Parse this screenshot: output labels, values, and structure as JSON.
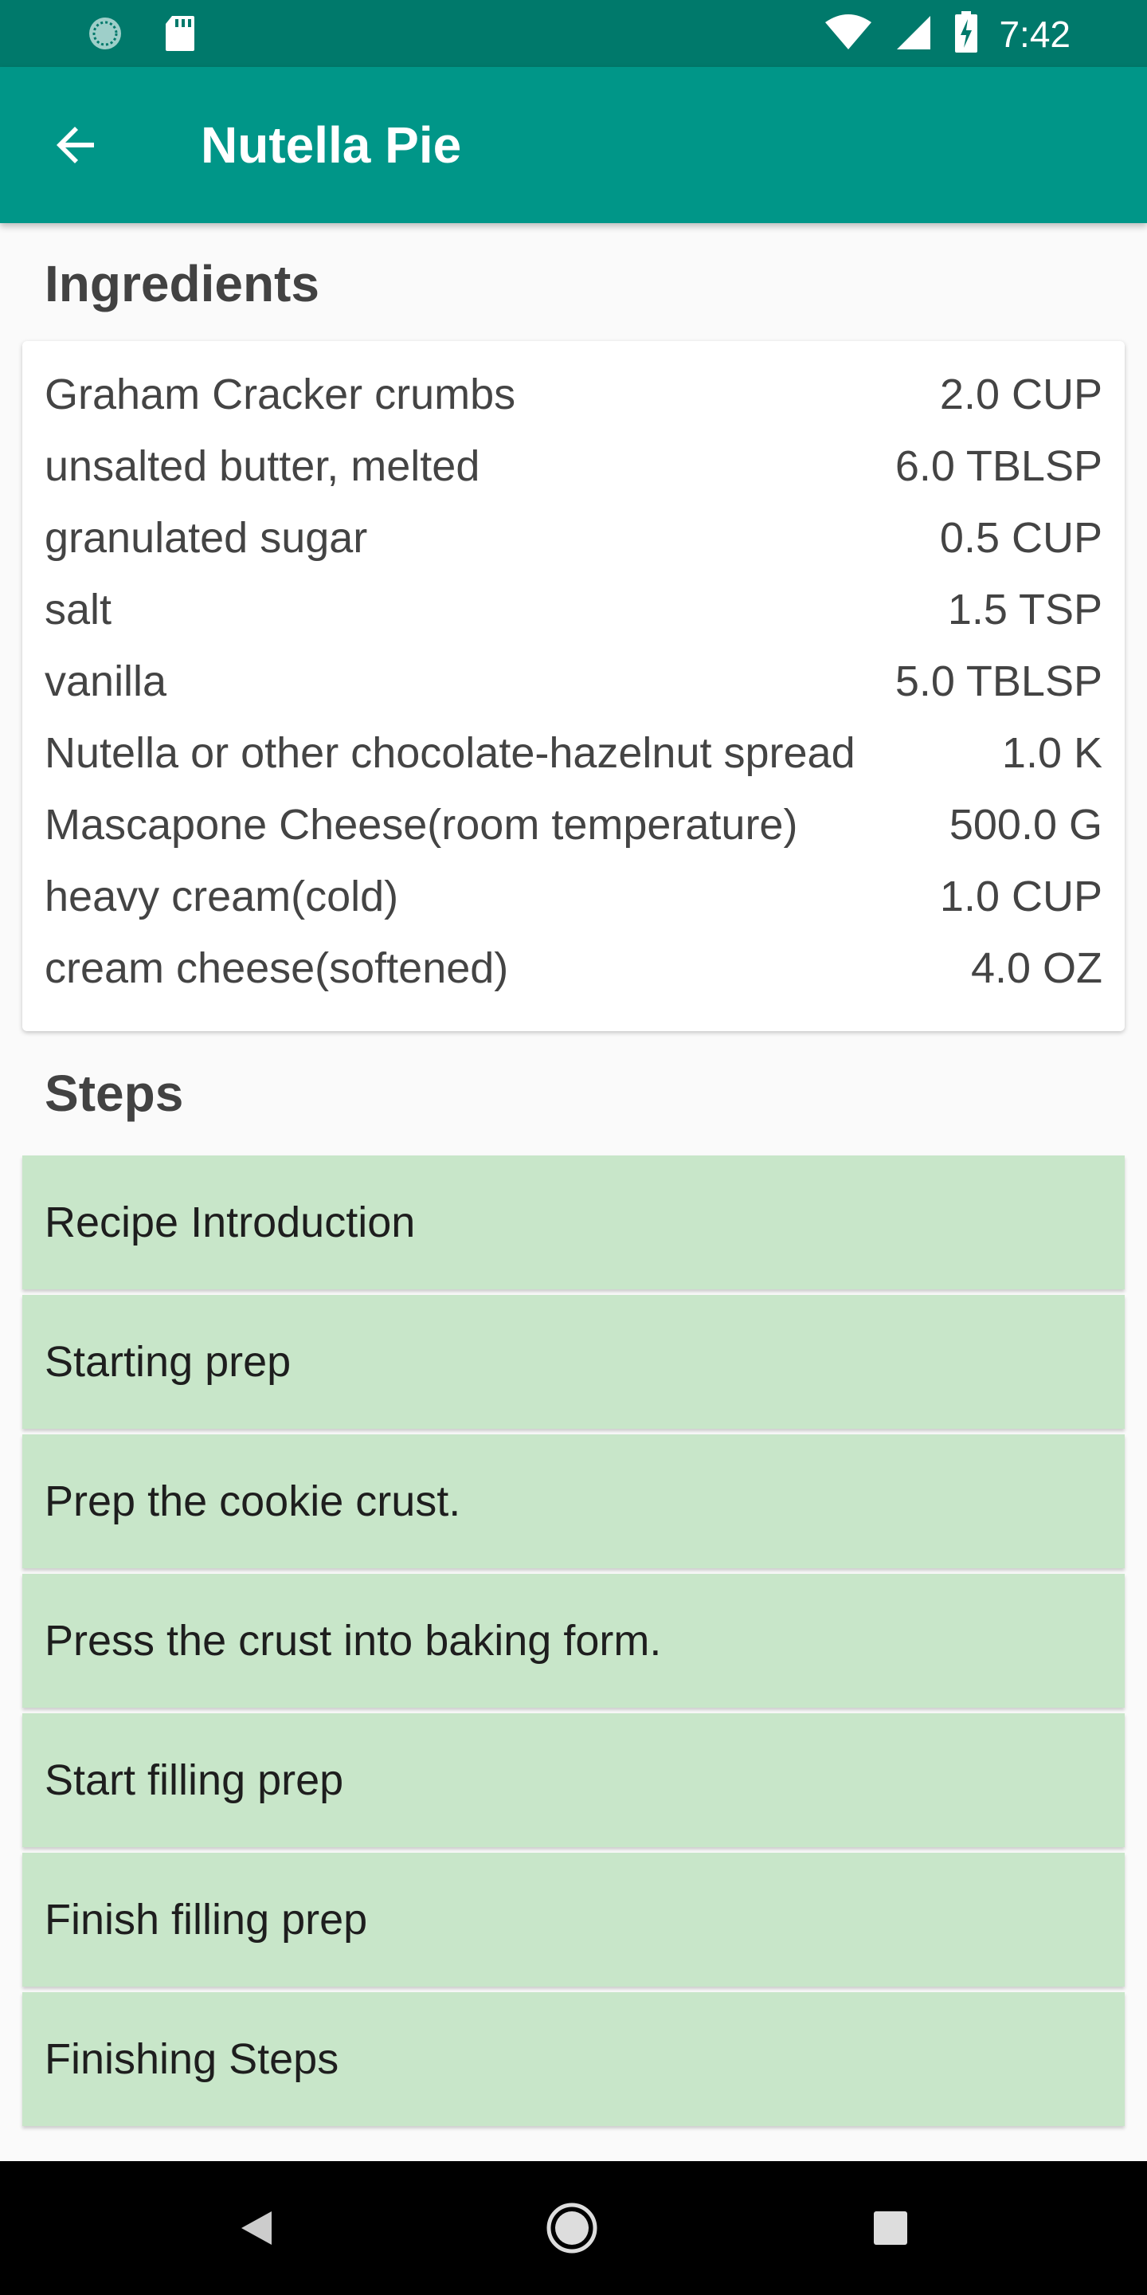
{
  "status_bar": {
    "time": "7:42",
    "icons": [
      "sync-icon",
      "sd-card-icon",
      "wifi-icon",
      "signal-icon",
      "battery-charging-icon"
    ]
  },
  "app_bar": {
    "title": "Nutella Pie",
    "back_icon": "arrow-left-icon"
  },
  "ingredients": {
    "title": "Ingredients",
    "items": [
      {
        "name": "Graham Cracker crumbs",
        "quantity": "2.0 CUP"
      },
      {
        "name": "unsalted butter, melted",
        "quantity": "6.0 TBLSP"
      },
      {
        "name": "granulated sugar",
        "quantity": "0.5 CUP"
      },
      {
        "name": "salt",
        "quantity": "1.5 TSP"
      },
      {
        "name": "vanilla",
        "quantity": "5.0 TBLSP"
      },
      {
        "name": "Nutella or other chocolate-hazelnut spread",
        "quantity": "1.0 K"
      },
      {
        "name": "Mascapone Cheese(room temperature)",
        "quantity": "500.0 G"
      },
      {
        "name": "heavy cream(cold)",
        "quantity": "1.0 CUP"
      },
      {
        "name": "cream cheese(softened)",
        "quantity": "4.0 OZ"
      }
    ]
  },
  "steps": {
    "title": "Steps",
    "items": [
      {
        "label": "Recipe Introduction"
      },
      {
        "label": "Starting prep"
      },
      {
        "label": "Prep the cookie crust."
      },
      {
        "label": "Press the crust into baking form."
      },
      {
        "label": "Start filling prep"
      },
      {
        "label": "Finish filling prep"
      },
      {
        "label": "Finishing Steps"
      }
    ]
  },
  "nav_bar": {
    "buttons": [
      "back-triangle-icon",
      "home-circle-icon",
      "recents-square-icon"
    ]
  },
  "colors": {
    "status_bar": "#00796b",
    "app_bar": "#009688",
    "step_background": "#c8e6c9",
    "background": "#fafafa"
  }
}
